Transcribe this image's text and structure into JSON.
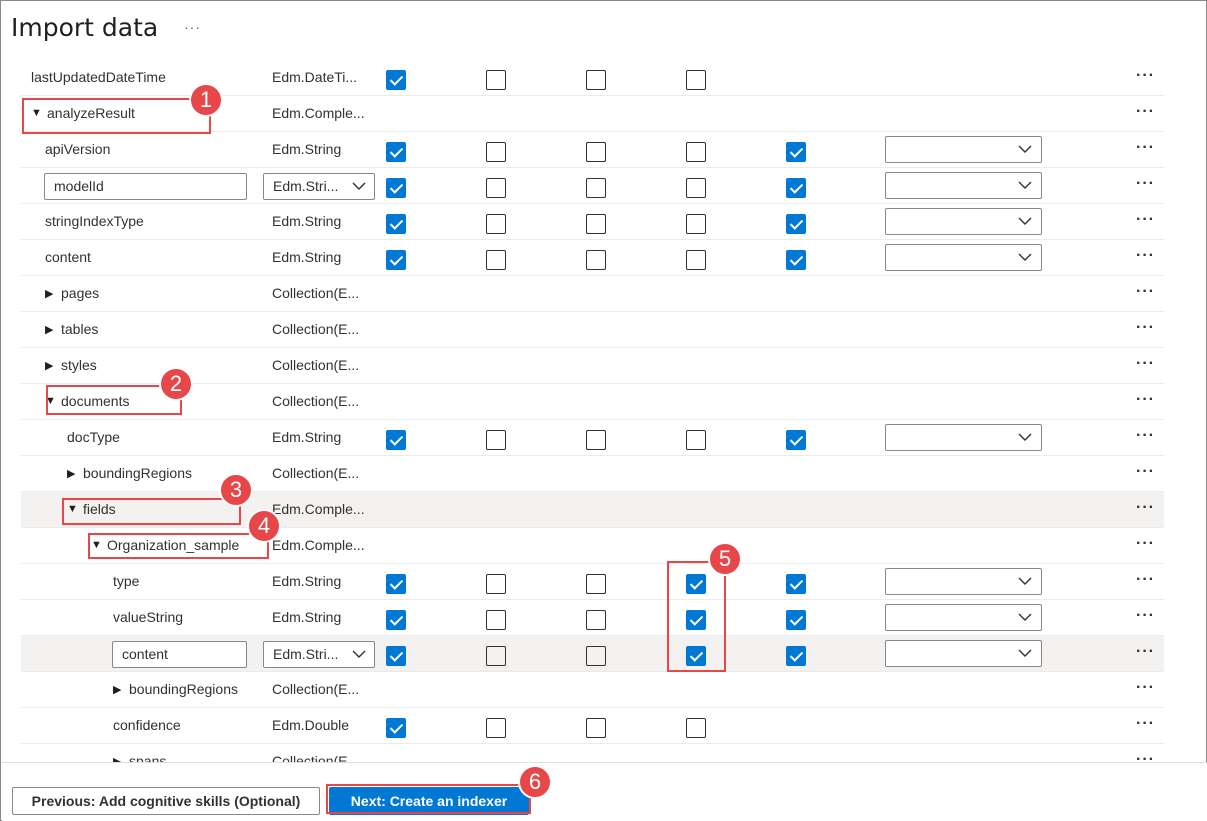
{
  "page": {
    "title": "Import data",
    "more_label": "···"
  },
  "rows": [
    {
      "name": "lastUpdatedDateTime",
      "type": "Edm.DateTi...",
      "indent": 0,
      "expander": "none",
      "checks": [
        true,
        false,
        false,
        false
      ],
      "dropdown": false
    },
    {
      "name": "analyzeResult",
      "type": "Edm.Comple...",
      "indent": 0,
      "expander": "expanded",
      "checks": [],
      "dropdown": false
    },
    {
      "name": "apiVersion",
      "type": "Edm.String",
      "indent": 1,
      "expander": "none",
      "checks": [
        true,
        false,
        false,
        false,
        true
      ],
      "dropdown": true
    },
    {
      "name": "modelId",
      "type": "Edm.Stri...",
      "indent": 1,
      "expander": "none",
      "editable": true,
      "checks": [
        true,
        false,
        false,
        false,
        true
      ],
      "dropdown": true
    },
    {
      "name": "stringIndexType",
      "type": "Edm.String",
      "indent": 1,
      "expander": "none",
      "checks": [
        true,
        false,
        false,
        false,
        true
      ],
      "dropdown": true
    },
    {
      "name": "content",
      "type": "Edm.String",
      "indent": 1,
      "expander": "none",
      "checks": [
        true,
        false,
        false,
        false,
        true
      ],
      "dropdown": true
    },
    {
      "name": "pages",
      "type": "Collection(E...",
      "indent": 1,
      "expander": "collapsed",
      "checks": [],
      "dropdown": false
    },
    {
      "name": "tables",
      "type": "Collection(E...",
      "indent": 1,
      "expander": "collapsed",
      "checks": [],
      "dropdown": false
    },
    {
      "name": "styles",
      "type": "Collection(E...",
      "indent": 1,
      "expander": "collapsed",
      "checks": [],
      "dropdown": false
    },
    {
      "name": "documents",
      "type": "Collection(E...",
      "indent": 1,
      "expander": "expanded",
      "checks": [],
      "dropdown": false
    },
    {
      "name": "docType",
      "type": "Edm.String",
      "indent": 2,
      "expander": "none",
      "checks": [
        true,
        false,
        false,
        false,
        true
      ],
      "dropdown": true
    },
    {
      "name": "boundingRegions",
      "type": "Collection(E...",
      "indent": 2,
      "expander": "collapsed",
      "checks": [],
      "dropdown": false
    },
    {
      "name": "fields",
      "type": "Edm.Comple...",
      "indent": 2,
      "expander": "expanded",
      "highlight": true,
      "checks": [],
      "dropdown": false
    },
    {
      "name": "Organization_sample",
      "type": "Edm.Comple...",
      "indent": 3,
      "expander": "expanded",
      "checks": [],
      "dropdown": false
    },
    {
      "name": "type",
      "type": "Edm.String",
      "indent": 4,
      "expander": "none",
      "checks": [
        true,
        false,
        false,
        true,
        true
      ],
      "dropdown": true
    },
    {
      "name": "valueString",
      "type": "Edm.String",
      "indent": 4,
      "expander": "none",
      "checks": [
        true,
        false,
        false,
        true,
        true
      ],
      "dropdown": true
    },
    {
      "name": "content",
      "type": "Edm.Stri...",
      "indent": 4,
      "expander": "none",
      "editable": true,
      "highlight": true,
      "checks": [
        true,
        false,
        false,
        true,
        true
      ],
      "dropdown": true
    },
    {
      "name": "boundingRegions",
      "type": "Collection(E...",
      "indent": 4,
      "expander": "collapsed",
      "checks": [],
      "dropdown": false
    },
    {
      "name": "confidence",
      "type": "Edm.Double",
      "indent": 4,
      "expander": "none",
      "checks": [
        true,
        false,
        false,
        false
      ],
      "dropdown": false
    },
    {
      "name": "spans",
      "type": "Collection(E...",
      "indent": 4,
      "expander": "collapsed",
      "checks": [],
      "dropdown": false
    }
  ],
  "callouts": [
    "1",
    "2",
    "3",
    "4",
    "5",
    "6"
  ],
  "footer": {
    "previous_label": "Previous: Add cognitive skills (Optional)",
    "next_label": "Next: Create an indexer"
  },
  "colors": {
    "accent": "#0078d4",
    "callout": "#e8474a",
    "highlight_row": "#f3f2f1"
  }
}
